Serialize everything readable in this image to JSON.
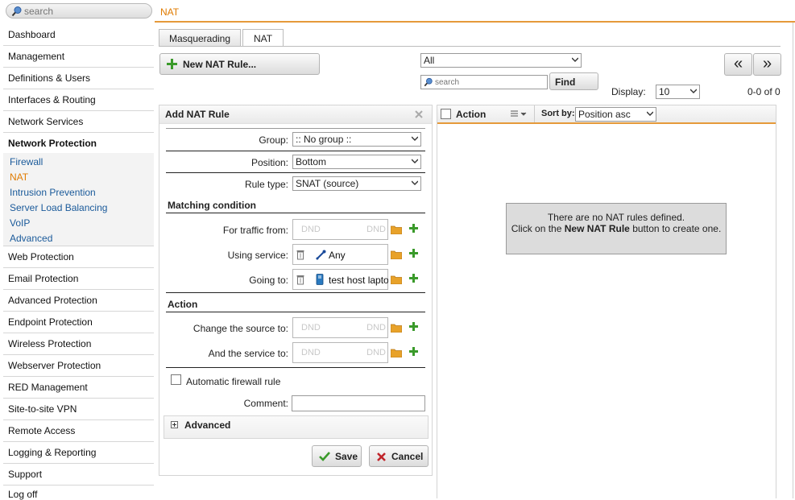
{
  "sidebar": {
    "search_placeholder": "search",
    "items": [
      {
        "label": "Dashboard"
      },
      {
        "label": "Management"
      },
      {
        "label": "Definitions & Users"
      },
      {
        "label": "Interfaces & Routing"
      },
      {
        "label": "Network Services"
      },
      {
        "label": "Network Protection"
      },
      {
        "label": "Web Protection"
      },
      {
        "label": "Email Protection"
      },
      {
        "label": "Advanced Protection"
      },
      {
        "label": "Endpoint Protection"
      },
      {
        "label": "Wireless Protection"
      },
      {
        "label": "Webserver Protection"
      },
      {
        "label": "RED Management"
      },
      {
        "label": "Site-to-site VPN"
      },
      {
        "label": "Remote Access"
      },
      {
        "label": "Logging & Reporting"
      },
      {
        "label": "Support"
      },
      {
        "label": "Log off"
      }
    ],
    "subitems": [
      {
        "label": "Firewall"
      },
      {
        "label": "NAT"
      },
      {
        "label": "Intrusion Prevention"
      },
      {
        "label": "Server Load Balancing"
      },
      {
        "label": "VoIP"
      },
      {
        "label": "Advanced"
      }
    ]
  },
  "header": {
    "title": "NAT"
  },
  "tabs": [
    {
      "label": "Masquerading"
    },
    {
      "label": "NAT"
    }
  ],
  "toolbar": {
    "new_rule_label": "New NAT Rule...",
    "filter_value": "All",
    "search_placeholder": "search",
    "find_label": "Find",
    "display_label": "Display:",
    "display_value": "10",
    "count_text": "0-0 of 0",
    "prev_label": "«",
    "next_label": "»"
  },
  "form": {
    "title": "Add NAT Rule",
    "group_label": "Group:",
    "group_value": ":: No group ::",
    "position_label": "Position:",
    "position_value": "Bottom",
    "rule_type_label": "Rule type:",
    "rule_type_value": "SNAT (source)",
    "matching_heading": "Matching condition",
    "traffic_from_label": "For traffic from:",
    "using_service_label": "Using service:",
    "using_service_value": "Any",
    "going_to_label": "Going to:",
    "going_to_value": "test host laptop",
    "action_heading": "Action",
    "change_source_label": "Change the source to:",
    "and_service_label": "And the service to:",
    "dnd_text": "DND",
    "auto_fw_label": "Automatic firewall rule",
    "comment_label": "Comment:",
    "advanced_label": "Advanced",
    "save_label": "Save",
    "cancel_label": "Cancel"
  },
  "list": {
    "action_col": "Action",
    "sort_label": "Sort by:",
    "sort_value": "Position asc",
    "empty_line1": "There are no NAT rules defined.",
    "empty_pre": "Click on the ",
    "empty_bold": "New NAT Rule",
    "empty_post": " button to create one."
  },
  "colors": {
    "accent": "#e07b00",
    "header_line": "#e59a3a",
    "link": "#1a5a9a",
    "add_green": "#3a9a2a",
    "cancel_red": "#c0242a"
  }
}
